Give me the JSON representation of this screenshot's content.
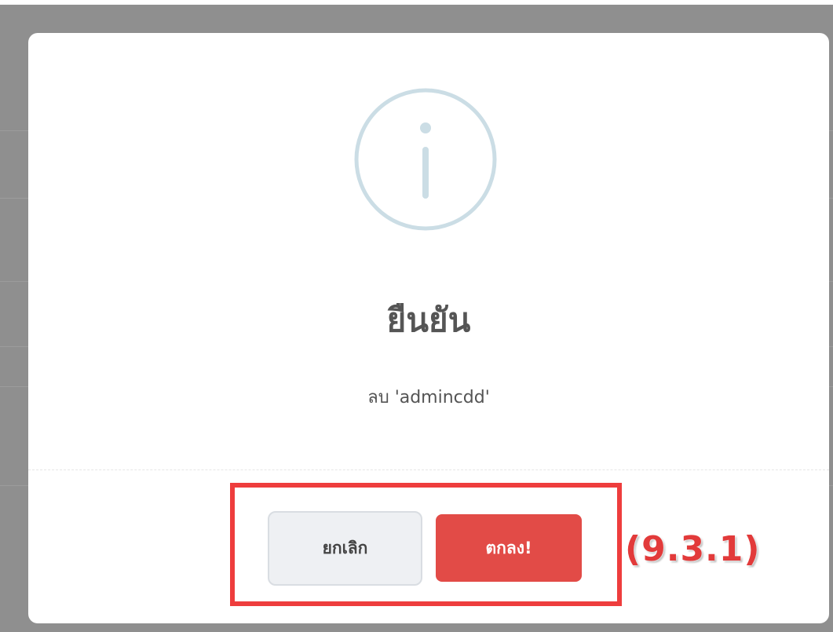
{
  "dialog": {
    "title": "ยืนยัน",
    "message": "ลบ 'admincdd'",
    "icon": "info-icon",
    "cancel_label": "ยกเลิก",
    "confirm_label": "ตกลง!"
  },
  "annotation": {
    "label": "(9.3.1)"
  },
  "colors": {
    "backdrop": "#8f8f8f",
    "icon_stroke": "#cbdde5",
    "confirm_button": "#e24b47",
    "cancel_button": "#eef0f3",
    "highlight": "#ee3d3d"
  }
}
